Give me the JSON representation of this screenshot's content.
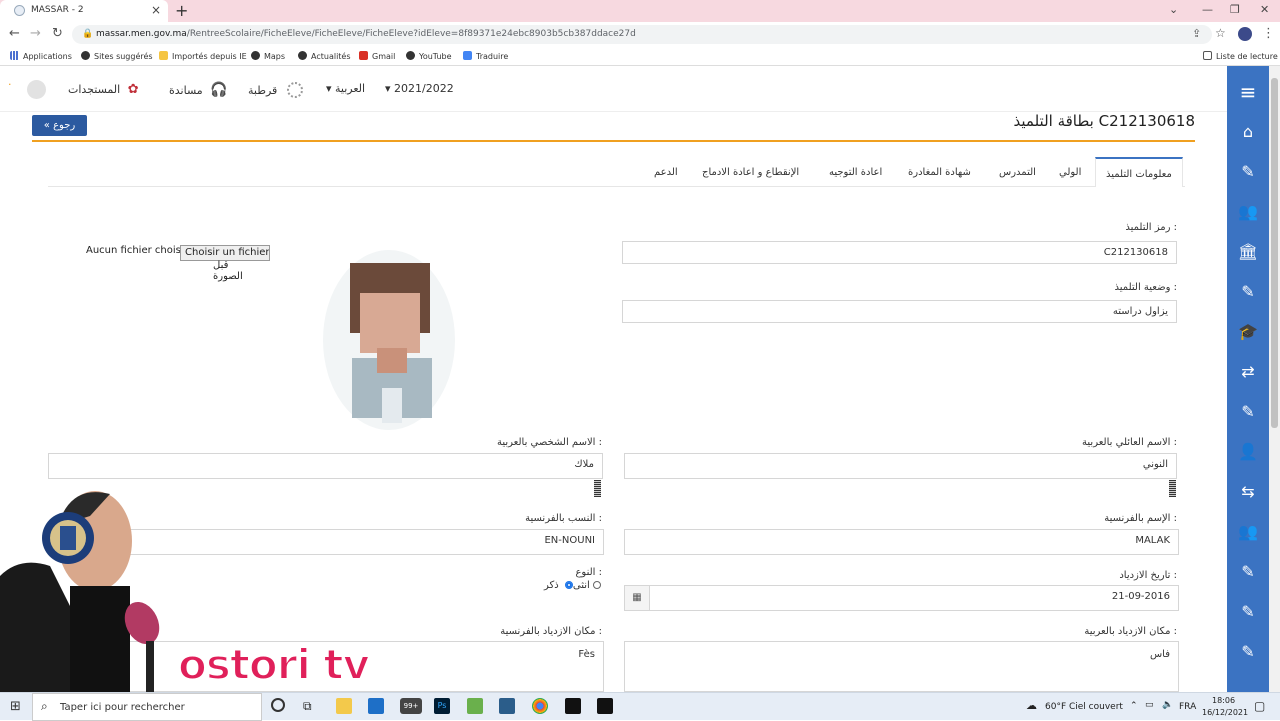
{
  "browser": {
    "tab_title": "MASSAR - 2",
    "url_host": "massar.men.gov.ma",
    "url_path": "/RentreeScolaire/FicheEleve/FicheEleve/FicheEleve?idEleve=8f89371e24ebc8903b5cb387ddace27d",
    "bookmarks": [
      "Applications",
      "Sites suggérés",
      "Importés depuis IE",
      "Maps",
      "Actualités",
      "Gmail",
      "YouTube",
      "Traduire"
    ],
    "reading_list": "Liste de lecture"
  },
  "header": {
    "year": "2021/2022",
    "language": "العربية",
    "qortoba": "قرطبة",
    "support": "مساندة",
    "news": "المستجدات"
  },
  "page": {
    "back": "رجوع",
    "title": "بطاقة التلميذ C212130618"
  },
  "tabs": [
    "معلومات التلميذ",
    "الولي",
    "التمدرس",
    "شهادة المغادرة",
    "اعادة التوجيه",
    "الإنقطاع و اعادة الادماج",
    "الدعم"
  ],
  "form": {
    "code_label": "رمز التلميذ :",
    "code_value": "C212130618",
    "status_label": "وضعية التلميذ :",
    "status_value": "يزاول دراسته",
    "file_none": "Aucun fichier choisi",
    "file_button": "Choisir un fichier",
    "upload_label": "قبل الصورة",
    "family_ar_label": "الاسم العائلي بالعربية :",
    "family_ar_value": "النوني",
    "first_ar_label": "الاسم الشخصي بالعربية :",
    "first_ar_value": "ملاك",
    "first_fr_label": "الإسم بالفرنسية :",
    "first_fr_value": "MALAK",
    "family_fr_label": "النسب بالفرنسية :",
    "family_fr_value": "EN-NOUNI",
    "birthdate_label": "تاريخ الازدياد :",
    "birthdate_value": "21-09-2016",
    "gender_label": "النوع :",
    "gender_male": "ذكر",
    "gender_female": "انثى",
    "birthplace_ar_label": "مكان الازدياد بالعربية :",
    "birthplace_ar_value": "فاس",
    "birthplace_fr_label": "مكان الازدياد بالفرنسية :",
    "birthplace_fr_value": "Fès"
  },
  "overlay": {
    "channel": "ostori tv"
  },
  "taskbar": {
    "search": "Taper ici pour rechercher",
    "weather": "60°F  Ciel couvert",
    "lang": "FRA",
    "time": "18:06",
    "date": "16/12/2021",
    "badge": "99+"
  },
  "colors": {
    "sidebar": "#3b73c2",
    "accent_line": "#f0a020",
    "back_button": "#2c5aa0",
    "overlay_text": "#e0205a"
  }
}
